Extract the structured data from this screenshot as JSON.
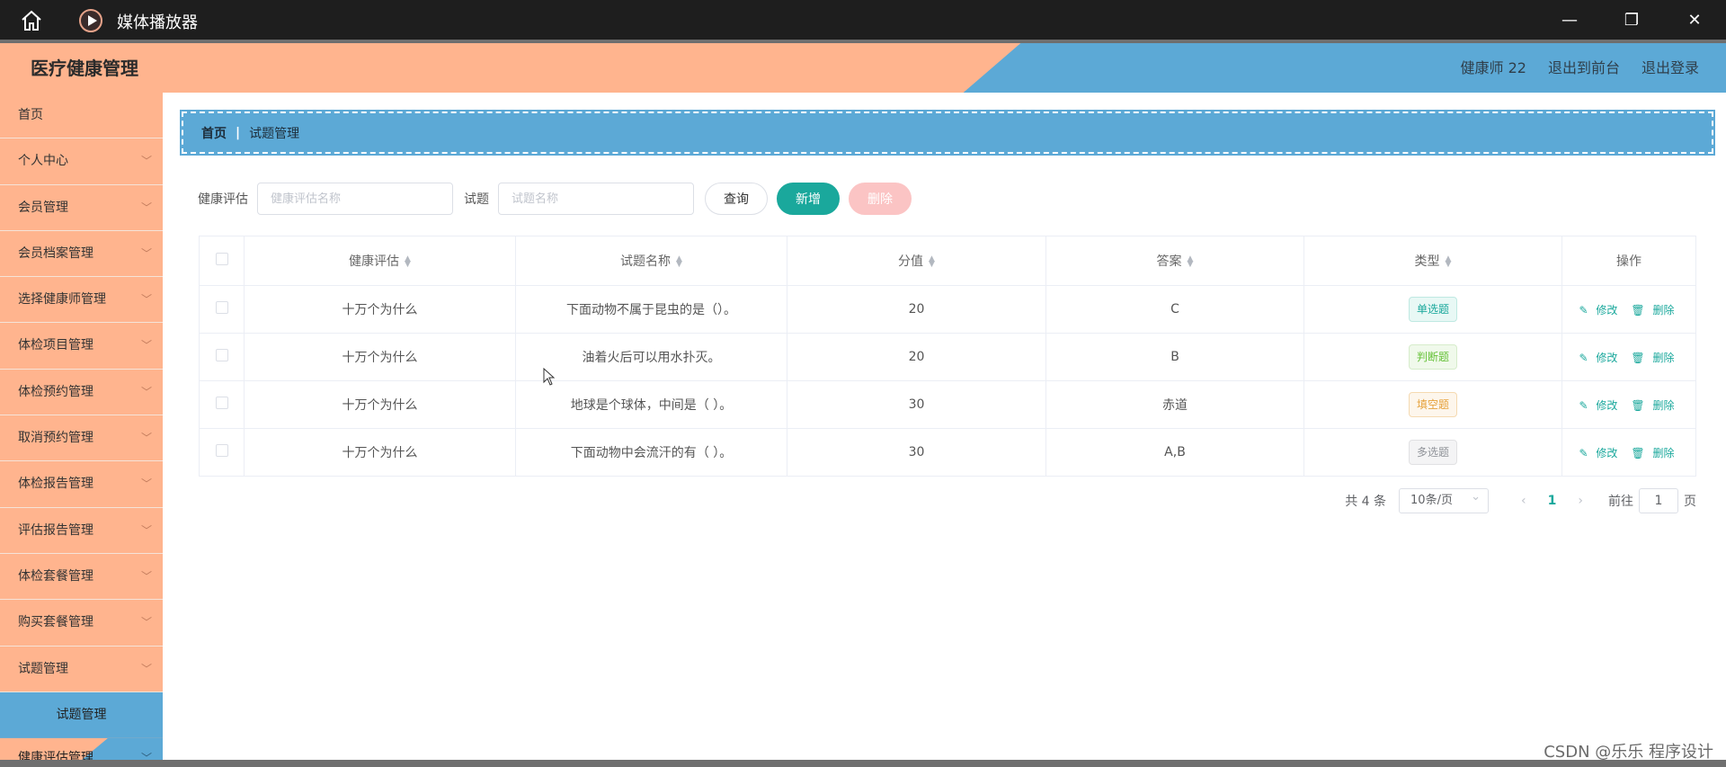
{
  "window": {
    "title": "媒体播放器",
    "minimize": "—",
    "maximize": "❐",
    "close": "✕"
  },
  "header": {
    "brand": "医疗健康管理",
    "user": "健康师 22",
    "to_front": "退出到前台",
    "logout": "退出登录"
  },
  "sidebar": {
    "items": [
      {
        "label": "首页",
        "chevron": false
      },
      {
        "label": "个人中心",
        "chevron": true
      },
      {
        "label": "会员管理",
        "chevron": true
      },
      {
        "label": "会员档案管理",
        "chevron": true
      },
      {
        "label": "选择健康师管理",
        "chevron": true
      },
      {
        "label": "体检项目管理",
        "chevron": true
      },
      {
        "label": "体检预约管理",
        "chevron": true
      },
      {
        "label": "取消预约管理",
        "chevron": true
      },
      {
        "label": "体检报告管理",
        "chevron": true
      },
      {
        "label": "评估报告管理",
        "chevron": true
      },
      {
        "label": "体检套餐管理",
        "chevron": true
      },
      {
        "label": "购买套餐管理",
        "chevron": true
      },
      {
        "label": "试题管理",
        "chevron": true
      }
    ],
    "active_sub": "试题管理",
    "last_item": "健康评估管理"
  },
  "breadcrumb": {
    "home": "首页",
    "separator": "|",
    "current": "试题管理"
  },
  "search": {
    "label1": "健康评估",
    "placeholder1": "健康评估名称",
    "label2": "试题",
    "placeholder2": "试题名称",
    "query": "查询",
    "add": "新增",
    "delete": "删除"
  },
  "table": {
    "columns": [
      "健康评估",
      "试题名称",
      "分值",
      "答案",
      "类型",
      "操作"
    ],
    "rows": [
      {
        "eval": "十万个为什么",
        "question": "下面动物不属于昆虫的是（）。",
        "score": "20",
        "answer": "C",
        "type": "单选题",
        "type_style": "green"
      },
      {
        "eval": "十万个为什么",
        "question": "油着火后可以用水扑灭。",
        "score": "20",
        "answer": "B",
        "type": "判断题",
        "type_style": "lime"
      },
      {
        "eval": "十万个为什么",
        "question": "地球是个球体，中间是（ ）。",
        "score": "30",
        "answer": "赤道",
        "type": "填空题",
        "type_style": "orange"
      },
      {
        "eval": "十万个为什么",
        "question": "下面动物中会流汗的有（ ）。",
        "score": "30",
        "answer": "A,B",
        "type": "多选题",
        "type_style": "gray"
      }
    ],
    "edit_label": "修改",
    "delete_label": "删除"
  },
  "pagination": {
    "total": "共 4 条",
    "page_size": "10条/页",
    "current_page": "1",
    "goto_label": "前往",
    "goto_value": "1",
    "page_suffix": "页"
  },
  "watermark": "CSDN @乐乐 程序设计"
}
